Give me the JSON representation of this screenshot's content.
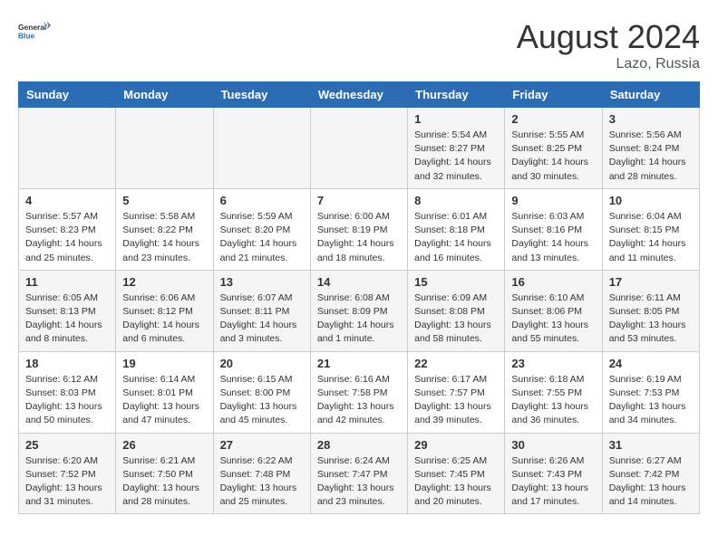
{
  "header": {
    "logo_general": "General",
    "logo_blue": "Blue",
    "month_year": "August 2024",
    "location": "Lazo, Russia"
  },
  "days_of_week": [
    "Sunday",
    "Monday",
    "Tuesday",
    "Wednesday",
    "Thursday",
    "Friday",
    "Saturday"
  ],
  "weeks": [
    [
      {
        "day": "",
        "text": ""
      },
      {
        "day": "",
        "text": ""
      },
      {
        "day": "",
        "text": ""
      },
      {
        "day": "",
        "text": ""
      },
      {
        "day": "1",
        "text": "Sunrise: 5:54 AM\nSunset: 8:27 PM\nDaylight: 14 hours\nand 32 minutes."
      },
      {
        "day": "2",
        "text": "Sunrise: 5:55 AM\nSunset: 8:25 PM\nDaylight: 14 hours\nand 30 minutes."
      },
      {
        "day": "3",
        "text": "Sunrise: 5:56 AM\nSunset: 8:24 PM\nDaylight: 14 hours\nand 28 minutes."
      }
    ],
    [
      {
        "day": "4",
        "text": "Sunrise: 5:57 AM\nSunset: 8:23 PM\nDaylight: 14 hours\nand 25 minutes."
      },
      {
        "day": "5",
        "text": "Sunrise: 5:58 AM\nSunset: 8:22 PM\nDaylight: 14 hours\nand 23 minutes."
      },
      {
        "day": "6",
        "text": "Sunrise: 5:59 AM\nSunset: 8:20 PM\nDaylight: 14 hours\nand 21 minutes."
      },
      {
        "day": "7",
        "text": "Sunrise: 6:00 AM\nSunset: 8:19 PM\nDaylight: 14 hours\nand 18 minutes."
      },
      {
        "day": "8",
        "text": "Sunrise: 6:01 AM\nSunset: 8:18 PM\nDaylight: 14 hours\nand 16 minutes."
      },
      {
        "day": "9",
        "text": "Sunrise: 6:03 AM\nSunset: 8:16 PM\nDaylight: 14 hours\nand 13 minutes."
      },
      {
        "day": "10",
        "text": "Sunrise: 6:04 AM\nSunset: 8:15 PM\nDaylight: 14 hours\nand 11 minutes."
      }
    ],
    [
      {
        "day": "11",
        "text": "Sunrise: 6:05 AM\nSunset: 8:13 PM\nDaylight: 14 hours\nand 8 minutes."
      },
      {
        "day": "12",
        "text": "Sunrise: 6:06 AM\nSunset: 8:12 PM\nDaylight: 14 hours\nand 6 minutes."
      },
      {
        "day": "13",
        "text": "Sunrise: 6:07 AM\nSunset: 8:11 PM\nDaylight: 14 hours\nand 3 minutes."
      },
      {
        "day": "14",
        "text": "Sunrise: 6:08 AM\nSunset: 8:09 PM\nDaylight: 14 hours\nand 1 minute."
      },
      {
        "day": "15",
        "text": "Sunrise: 6:09 AM\nSunset: 8:08 PM\nDaylight: 13 hours\nand 58 minutes."
      },
      {
        "day": "16",
        "text": "Sunrise: 6:10 AM\nSunset: 8:06 PM\nDaylight: 13 hours\nand 55 minutes."
      },
      {
        "day": "17",
        "text": "Sunrise: 6:11 AM\nSunset: 8:05 PM\nDaylight: 13 hours\nand 53 minutes."
      }
    ],
    [
      {
        "day": "18",
        "text": "Sunrise: 6:12 AM\nSunset: 8:03 PM\nDaylight: 13 hours\nand 50 minutes."
      },
      {
        "day": "19",
        "text": "Sunrise: 6:14 AM\nSunset: 8:01 PM\nDaylight: 13 hours\nand 47 minutes."
      },
      {
        "day": "20",
        "text": "Sunrise: 6:15 AM\nSunset: 8:00 PM\nDaylight: 13 hours\nand 45 minutes."
      },
      {
        "day": "21",
        "text": "Sunrise: 6:16 AM\nSunset: 7:58 PM\nDaylight: 13 hours\nand 42 minutes."
      },
      {
        "day": "22",
        "text": "Sunrise: 6:17 AM\nSunset: 7:57 PM\nDaylight: 13 hours\nand 39 minutes."
      },
      {
        "day": "23",
        "text": "Sunrise: 6:18 AM\nSunset: 7:55 PM\nDaylight: 13 hours\nand 36 minutes."
      },
      {
        "day": "24",
        "text": "Sunrise: 6:19 AM\nSunset: 7:53 PM\nDaylight: 13 hours\nand 34 minutes."
      }
    ],
    [
      {
        "day": "25",
        "text": "Sunrise: 6:20 AM\nSunset: 7:52 PM\nDaylight: 13 hours\nand 31 minutes."
      },
      {
        "day": "26",
        "text": "Sunrise: 6:21 AM\nSunset: 7:50 PM\nDaylight: 13 hours\nand 28 minutes."
      },
      {
        "day": "27",
        "text": "Sunrise: 6:22 AM\nSunset: 7:48 PM\nDaylight: 13 hours\nand 25 minutes."
      },
      {
        "day": "28",
        "text": "Sunrise: 6:24 AM\nSunset: 7:47 PM\nDaylight: 13 hours\nand 23 minutes."
      },
      {
        "day": "29",
        "text": "Sunrise: 6:25 AM\nSunset: 7:45 PM\nDaylight: 13 hours\nand 20 minutes."
      },
      {
        "day": "30",
        "text": "Sunrise: 6:26 AM\nSunset: 7:43 PM\nDaylight: 13 hours\nand 17 minutes."
      },
      {
        "day": "31",
        "text": "Sunrise: 6:27 AM\nSunset: 7:42 PM\nDaylight: 13 hours\nand 14 minutes."
      }
    ]
  ]
}
